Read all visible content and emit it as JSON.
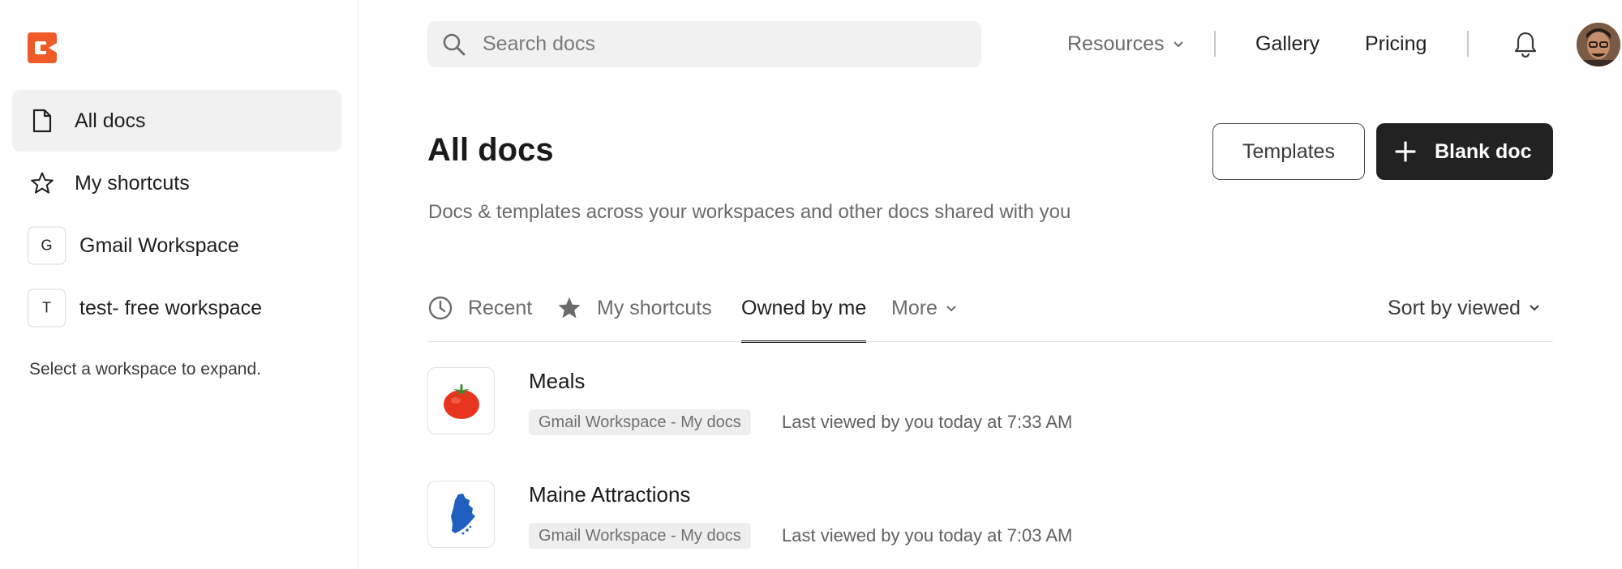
{
  "sidebar": {
    "logo_icon": "coda-logo-icon",
    "items": [
      {
        "label": "All docs",
        "icon": "document-icon",
        "active": true
      },
      {
        "label": "My shortcuts",
        "icon": "star-outline-icon",
        "active": false
      }
    ],
    "workspaces": [
      {
        "badge": "G",
        "label": "Gmail Workspace"
      },
      {
        "badge": "T",
        "label": "test- free workspace"
      }
    ],
    "hint": "Select a workspace to expand."
  },
  "topbar": {
    "search_placeholder": "Search docs",
    "resources_label": "Resources",
    "gallery_label": "Gallery",
    "pricing_label": "Pricing",
    "bell_icon": "bell-icon",
    "avatar_icon": "user-avatar"
  },
  "header": {
    "title": "All docs",
    "subtitle": "Docs & templates across your workspaces and other docs shared with you",
    "templates_button": "Templates",
    "blank_doc_button": "Blank doc"
  },
  "tabs": {
    "recent": "Recent",
    "shortcuts": "My shortcuts",
    "owned": "Owned by me",
    "more": "More",
    "active": "Owned by me",
    "sort_label": "Sort by viewed"
  },
  "docs": [
    {
      "title": "Meals",
      "workspace": "Gmail Workspace - My docs",
      "meta": "Last viewed by you today at 7:33 AM",
      "icon": "tomato-icon"
    },
    {
      "title": "Maine Attractions",
      "workspace": "Gmail Workspace - My docs",
      "meta": "Last viewed by you today at 7:03 AM",
      "icon": "maine-map-icon"
    }
  ],
  "colors": {
    "brand": "#f05a28",
    "primary_button": "#222222",
    "active_nav_bg": "#f1f1f1"
  }
}
